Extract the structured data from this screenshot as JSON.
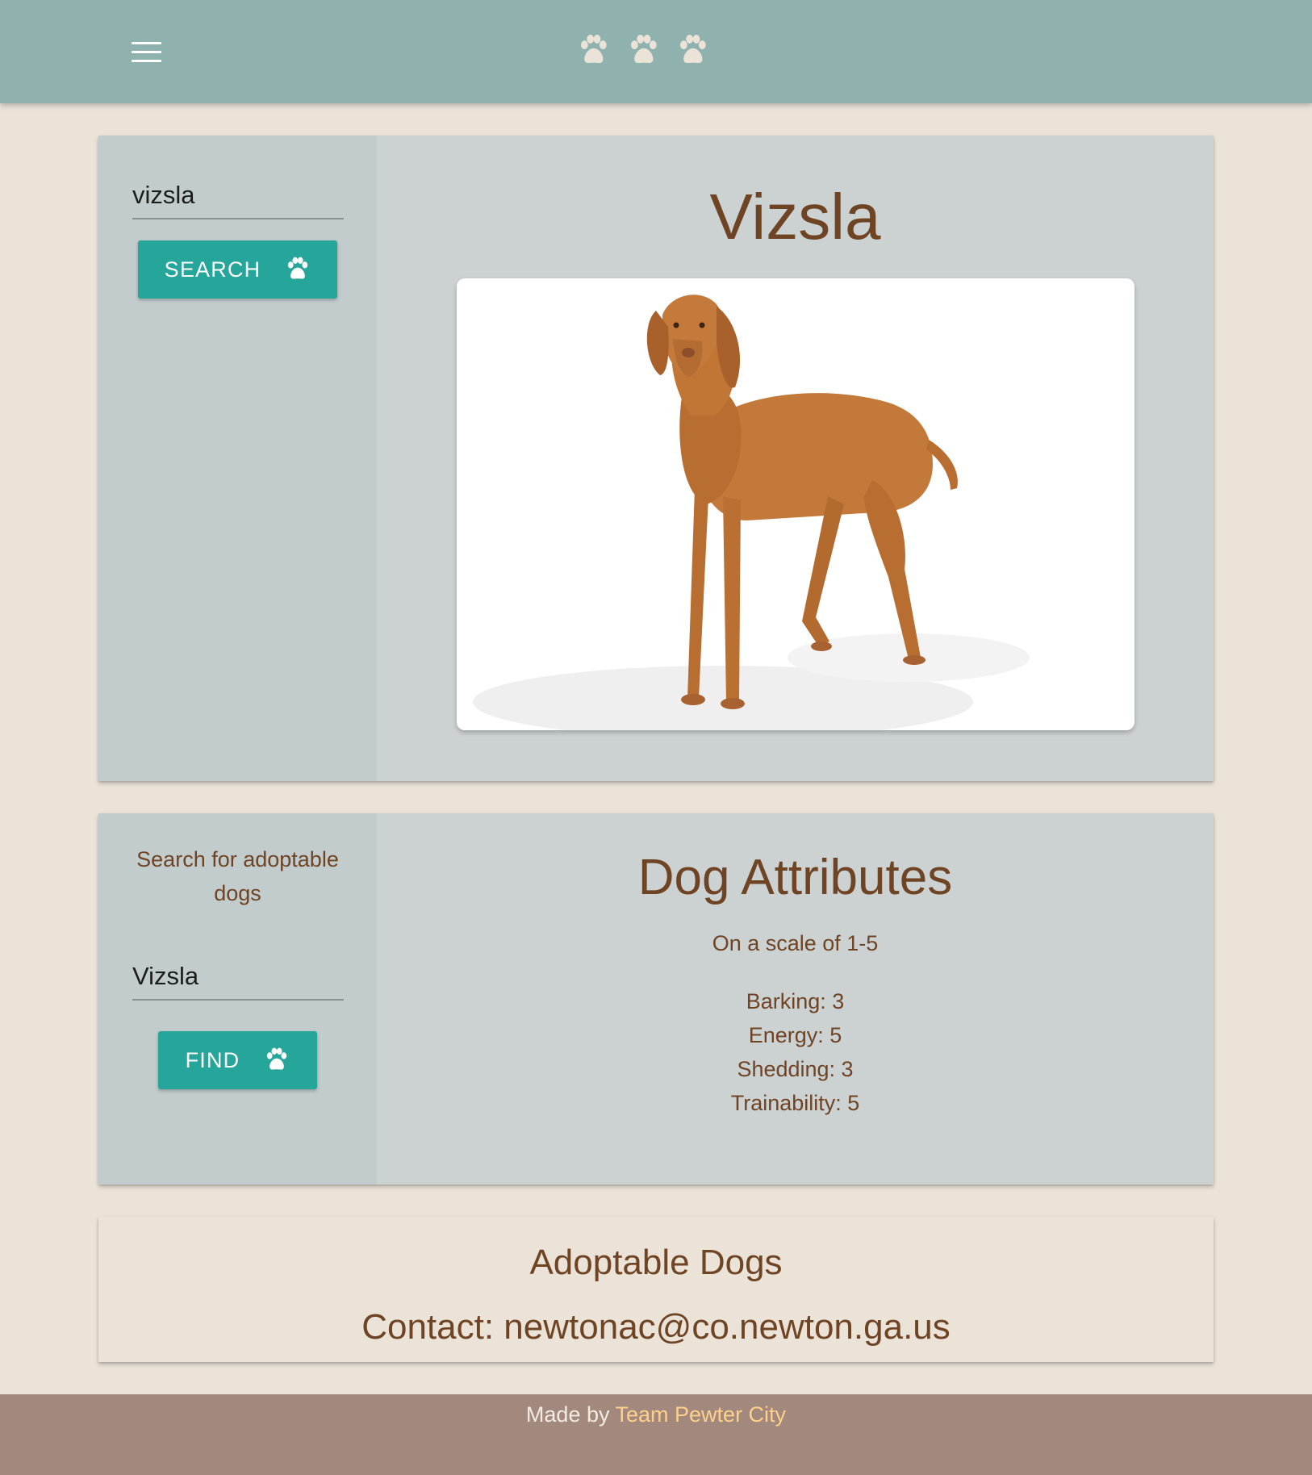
{
  "header": {
    "menu_icon": "hamburger-menu-icon",
    "logo_icons": [
      "paw-icon",
      "paw-icon",
      "paw-icon"
    ]
  },
  "breed_search": {
    "input_value": "vizsla",
    "button_label": "SEARCH",
    "button_icon": "paw-icon"
  },
  "breed": {
    "title": "Vizsla",
    "photo_subject": "dog-photo"
  },
  "adoptable_search": {
    "label": "Search for adoptable dogs",
    "input_value": "Vizsla",
    "button_label": "FIND",
    "button_icon": "paw-icon"
  },
  "attributes": {
    "title": "Dog Attributes",
    "scale_note": "On a scale of 1-5",
    "items": [
      {
        "text": "Barking: 3"
      },
      {
        "text": "Energy: 5"
      },
      {
        "text": "Shedding: 3"
      },
      {
        "text": "Trainability: 5"
      }
    ]
  },
  "contact": {
    "title": "Adoptable Dogs",
    "email_line": "Contact: newtonac@co.newton.ga.us"
  },
  "footer": {
    "made_by": "Made by",
    "team_name": "Team Pewter City"
  },
  "colors": {
    "header": "#8fb2af",
    "page_bg": "#ebe3d8",
    "accent_button": "#26a69a",
    "heading_text": "#6e4424",
    "footer": "#a2887d",
    "footer_link": "#ffd08a"
  }
}
